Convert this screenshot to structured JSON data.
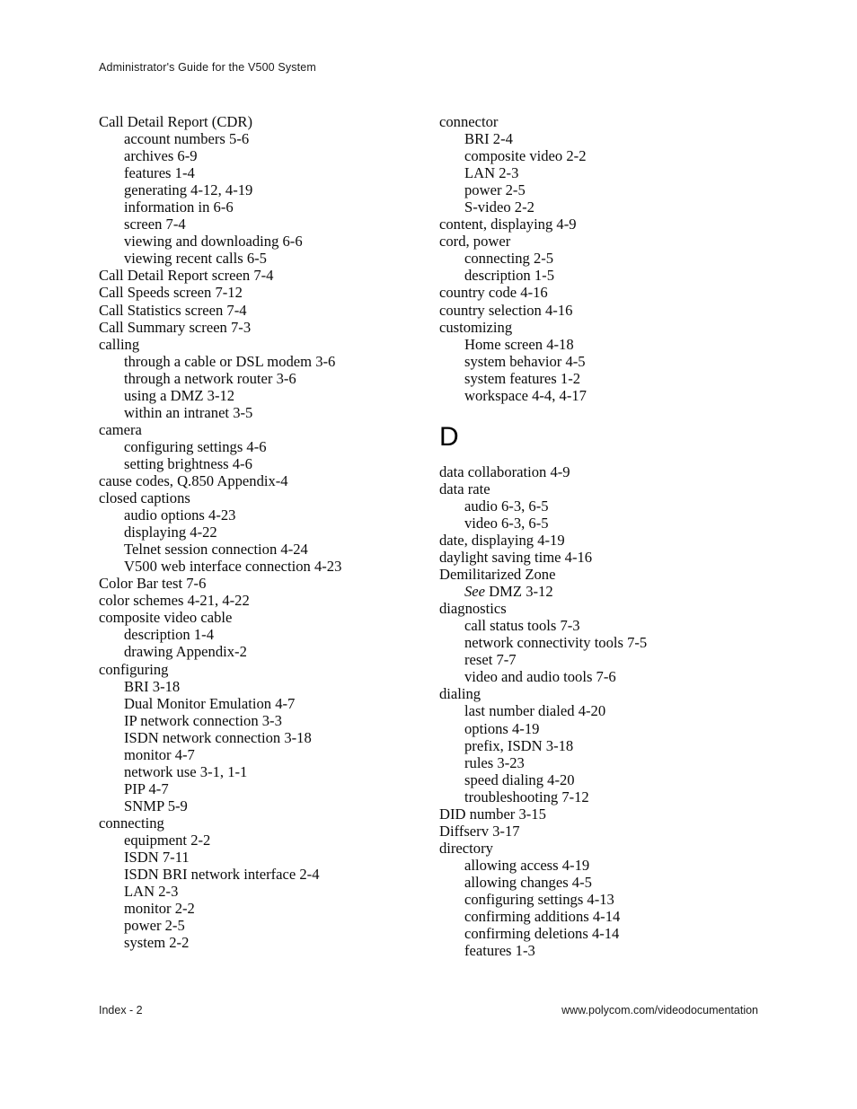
{
  "header": {
    "running_title": "Administrator's Guide for the V500 System"
  },
  "footer": {
    "page_label": "Index - 2",
    "url": "www.polycom.com/videodocumentation"
  },
  "columns": {
    "left": [
      {
        "level": 0,
        "text": "Call Detail Report (CDR)"
      },
      {
        "level": 1,
        "text": "account numbers 5-6"
      },
      {
        "level": 1,
        "text": "archives 6-9"
      },
      {
        "level": 1,
        "text": "features 1-4"
      },
      {
        "level": 1,
        "text": "generating 4-12, 4-19"
      },
      {
        "level": 1,
        "text": "information in 6-6"
      },
      {
        "level": 1,
        "text": "screen 7-4"
      },
      {
        "level": 1,
        "text": "viewing and downloading 6-6"
      },
      {
        "level": 1,
        "text": "viewing recent calls 6-5"
      },
      {
        "level": 0,
        "text": "Call Detail Report screen 7-4"
      },
      {
        "level": 0,
        "text": "Call Speeds screen 7-12"
      },
      {
        "level": 0,
        "text": "Call Statistics screen 7-4"
      },
      {
        "level": 0,
        "text": "Call Summary screen 7-3"
      },
      {
        "level": 0,
        "text": "calling"
      },
      {
        "level": 1,
        "text": "through a cable or DSL modem 3-6"
      },
      {
        "level": 1,
        "text": "through a network router 3-6"
      },
      {
        "level": 1,
        "text": "using a DMZ 3-12"
      },
      {
        "level": 1,
        "text": "within an intranet 3-5"
      },
      {
        "level": 0,
        "text": "camera"
      },
      {
        "level": 1,
        "text": "configuring settings 4-6"
      },
      {
        "level": 1,
        "text": "setting brightness 4-6"
      },
      {
        "level": 0,
        "text": "cause codes, Q.850 Appendix-4"
      },
      {
        "level": 0,
        "text": "closed captions"
      },
      {
        "level": 1,
        "text": "audio options 4-23"
      },
      {
        "level": 1,
        "text": "displaying 4-22"
      },
      {
        "level": 1,
        "text": "Telnet session connection 4-24"
      },
      {
        "level": 1,
        "text": "V500 web interface connection 4-23"
      },
      {
        "level": 0,
        "text": "Color Bar test 7-6"
      },
      {
        "level": 0,
        "text": "color schemes 4-21, 4-22"
      },
      {
        "level": 0,
        "text": "composite video cable"
      },
      {
        "level": 1,
        "text": "description 1-4"
      },
      {
        "level": 1,
        "text": "drawing Appendix-2"
      },
      {
        "level": 0,
        "text": "configuring"
      },
      {
        "level": 1,
        "text": "BRI 3-18"
      },
      {
        "level": 1,
        "text": "Dual Monitor Emulation 4-7"
      },
      {
        "level": 1,
        "text": "IP network connection 3-3"
      },
      {
        "level": 1,
        "text": "ISDN network connection 3-18"
      },
      {
        "level": 1,
        "text": "monitor 4-7"
      },
      {
        "level": 1,
        "text": "network use 3-1, 1-1"
      },
      {
        "level": 1,
        "text": "PIP 4-7"
      },
      {
        "level": 1,
        "text": "SNMP 5-9"
      },
      {
        "level": 0,
        "text": "connecting"
      },
      {
        "level": 1,
        "text": "equipment 2-2"
      },
      {
        "level": 1,
        "text": "ISDN 7-11"
      },
      {
        "level": 1,
        "text": "ISDN BRI network interface 2-4"
      },
      {
        "level": 1,
        "text": "LAN 2-3"
      },
      {
        "level": 1,
        "text": "monitor 2-2"
      },
      {
        "level": 1,
        "text": "power 2-5"
      },
      {
        "level": 1,
        "text": "system 2-2"
      }
    ],
    "right_before_heading": [
      {
        "level": 0,
        "text": "connector"
      },
      {
        "level": 1,
        "text": "BRI 2-4"
      },
      {
        "level": 1,
        "text": "composite video 2-2"
      },
      {
        "level": 1,
        "text": "LAN 2-3"
      },
      {
        "level": 1,
        "text": "power 2-5"
      },
      {
        "level": 1,
        "text": "S-video 2-2"
      },
      {
        "level": 0,
        "text": "content, displaying 4-9"
      },
      {
        "level": 0,
        "text": "cord, power"
      },
      {
        "level": 1,
        "text": "connecting 2-5"
      },
      {
        "level": 1,
        "text": "description 1-5"
      },
      {
        "level": 0,
        "text": "country code 4-16"
      },
      {
        "level": 0,
        "text": "country selection 4-16"
      },
      {
        "level": 0,
        "text": "customizing"
      },
      {
        "level": 1,
        "text": "Home screen 4-18"
      },
      {
        "level": 1,
        "text": "system behavior 4-5"
      },
      {
        "level": 1,
        "text": "system features 1-2"
      },
      {
        "level": 1,
        "text": "workspace 4-4, 4-17"
      }
    ],
    "right_heading": "D",
    "right_after_heading": [
      {
        "level": 0,
        "text": "data collaboration 4-9"
      },
      {
        "level": 0,
        "text": "data rate"
      },
      {
        "level": 1,
        "text": "audio 6-3, 6-5"
      },
      {
        "level": 1,
        "text": "video 6-3, 6-5"
      },
      {
        "level": 0,
        "text": "date, displaying 4-19"
      },
      {
        "level": 0,
        "text": "daylight saving time 4-16"
      },
      {
        "level": 0,
        "text": "Demilitarized Zone"
      },
      {
        "level": 1,
        "text": "See DMZ 3-12",
        "italic_prefix": "See",
        "rest": " DMZ 3-12"
      },
      {
        "level": 0,
        "text": "diagnostics"
      },
      {
        "level": 1,
        "text": "call status tools 7-3"
      },
      {
        "level": 1,
        "text": "network connectivity tools 7-5"
      },
      {
        "level": 1,
        "text": "reset 7-7"
      },
      {
        "level": 1,
        "text": "video and audio tools 7-6"
      },
      {
        "level": 0,
        "text": "dialing"
      },
      {
        "level": 1,
        "text": "last number dialed 4-20"
      },
      {
        "level": 1,
        "text": "options 4-19"
      },
      {
        "level": 1,
        "text": "prefix, ISDN 3-18"
      },
      {
        "level": 1,
        "text": "rules 3-23"
      },
      {
        "level": 1,
        "text": "speed dialing 4-20"
      },
      {
        "level": 1,
        "text": "troubleshooting 7-12"
      },
      {
        "level": 0,
        "text": "DID number 3-15"
      },
      {
        "level": 0,
        "text": "Diffserv 3-17"
      },
      {
        "level": 0,
        "text": "directory"
      },
      {
        "level": 1,
        "text": "allowing access 4-19"
      },
      {
        "level": 1,
        "text": "allowing changes 4-5"
      },
      {
        "level": 1,
        "text": "configuring settings 4-13"
      },
      {
        "level": 1,
        "text": "confirming additions 4-14"
      },
      {
        "level": 1,
        "text": "confirming deletions 4-14"
      },
      {
        "level": 1,
        "text": "features 1-3"
      }
    ]
  }
}
